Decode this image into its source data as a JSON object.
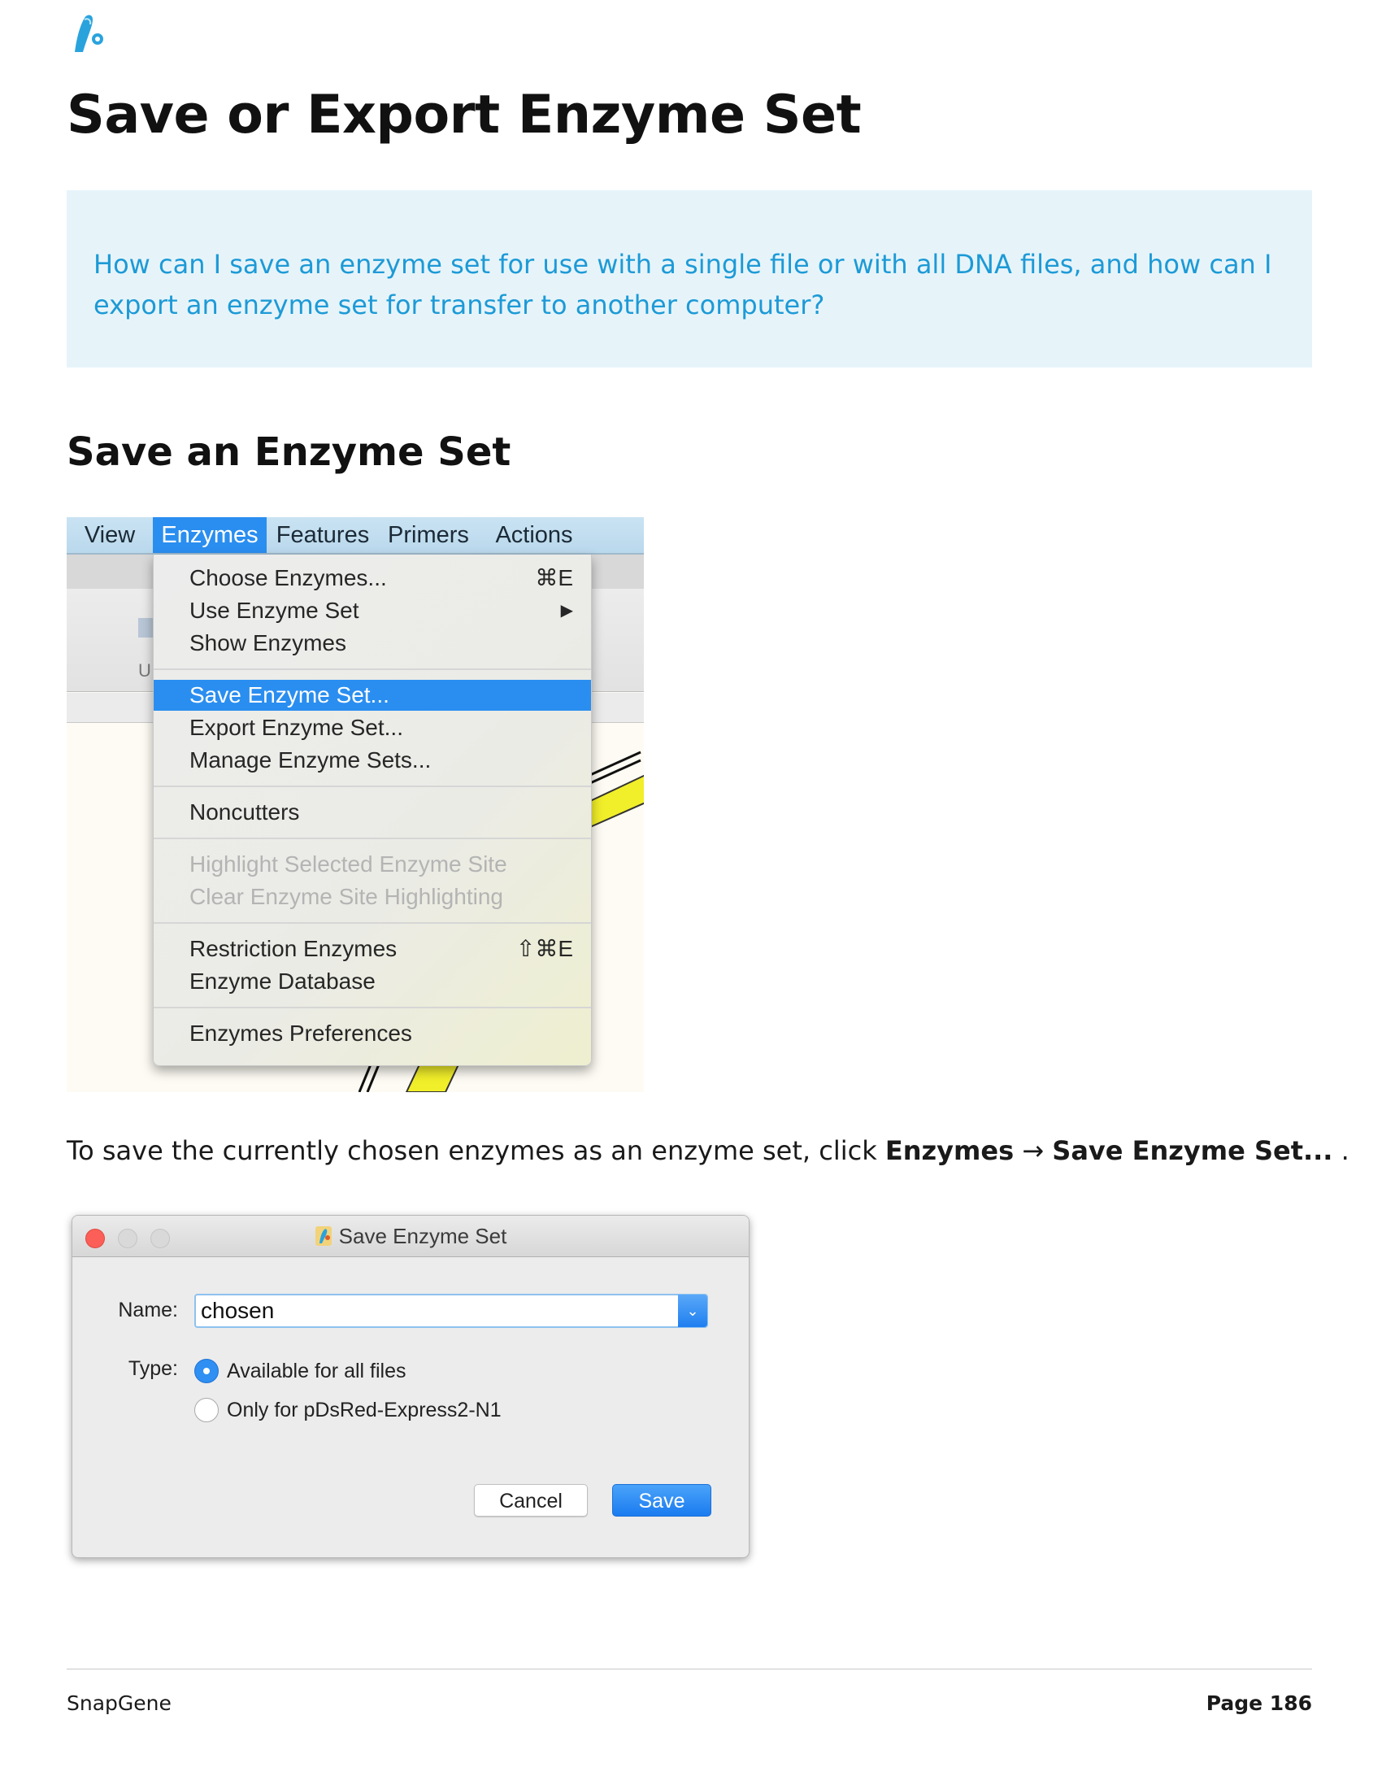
{
  "page": {
    "title": "Save or Export Enzyme Set",
    "callout": "How can I save an enzyme set for use with a single file or with all DNA files, and how can I export an enzyme set for transfer to another computer?",
    "section_heading": "Save an Enzyme Set",
    "instruction": {
      "prefix": "To save the currently chosen enzymes as an enzyme set, click ",
      "menu": "Enzymes",
      "arrow": "→",
      "item": "Save Enzyme Set...",
      "suffix": " ."
    }
  },
  "menu_screenshot": {
    "menubar": [
      "View",
      "Enzymes",
      "Features",
      "Primers",
      "Actions"
    ],
    "active_menu": "Enzymes",
    "toolbar_label_stub": "U",
    "menu_items": [
      {
        "label": "Choose Enzymes...",
        "shortcut": "⌘E",
        "state": "normal"
      },
      {
        "label": "Use Enzyme Set",
        "shortcut": "▶",
        "state": "normal"
      },
      {
        "label": "Show Enzymes",
        "shortcut": "",
        "state": "normal"
      },
      {
        "label": "Save Enzyme Set...",
        "shortcut": "",
        "state": "highlighted"
      },
      {
        "label": "Export Enzyme Set...",
        "shortcut": "",
        "state": "normal"
      },
      {
        "label": "Manage Enzyme Sets...",
        "shortcut": "",
        "state": "normal"
      },
      {
        "label": "Noncutters",
        "shortcut": "",
        "state": "normal"
      },
      {
        "label": "Highlight Selected Enzyme Site",
        "shortcut": "",
        "state": "disabled"
      },
      {
        "label": "Clear Enzyme Site Highlighting",
        "shortcut": "",
        "state": "disabled"
      },
      {
        "label": "Restriction Enzymes",
        "shortcut": "⇧⌘E",
        "state": "normal"
      },
      {
        "label": "Enzyme Database",
        "shortcut": "",
        "state": "normal"
      },
      {
        "label": "Enzymes Preferences",
        "shortcut": "",
        "state": "normal"
      }
    ]
  },
  "dialog": {
    "title": "Save Enzyme Set",
    "name_label": "Name:",
    "name_value": "chosen",
    "type_label": "Type:",
    "options": [
      {
        "label": "Available for all files",
        "selected": true
      },
      {
        "label": "Only for pDsRed-Express2-N1",
        "selected": false
      }
    ],
    "cancel_label": "Cancel",
    "save_label": "Save"
  },
  "footer": {
    "left": "SnapGene",
    "right": "Page 186"
  },
  "colors": {
    "callout_bg": "#e6f4fa",
    "callout_text": "#1d9ad6",
    "mac_accent": "#2a8ef0",
    "map_yellow": "#f1ee2a"
  },
  "icons": {
    "logo": "snapgene-logo-icon",
    "dialog_icon": "snapgene-app-icon",
    "combo_arrow": "chevron-down-icon",
    "submenu_arrow": "submenu-arrow-icon"
  }
}
